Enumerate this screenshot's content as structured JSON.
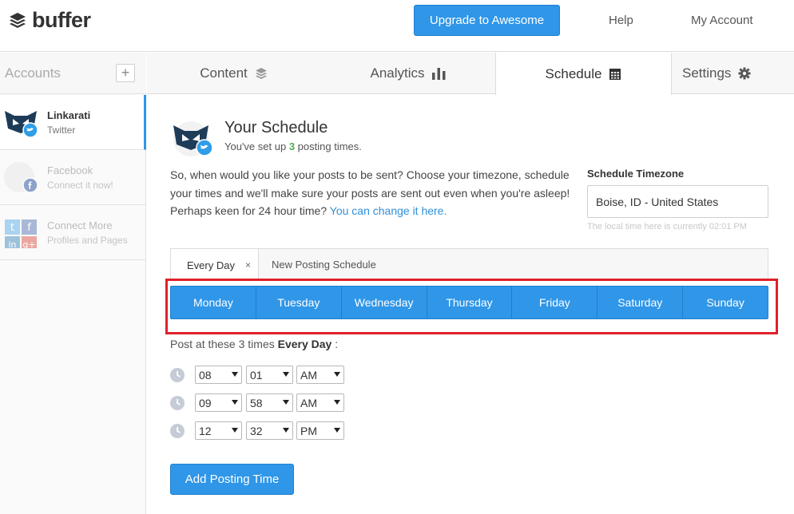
{
  "brand": {
    "name": "buffer"
  },
  "header": {
    "upgrade_label": "Upgrade to Awesome",
    "help_label": "Help",
    "account_label": "My Account"
  },
  "sidebar": {
    "title": "Accounts",
    "add_label": "+",
    "items": [
      {
        "name": "Linkarati",
        "sub": "Twitter"
      },
      {
        "name": "Facebook",
        "sub": "Connect it now!"
      },
      {
        "name": "Connect More",
        "sub": "Profiles and Pages"
      }
    ]
  },
  "tabs": [
    {
      "label": "Content",
      "icon": "layers-icon"
    },
    {
      "label": "Analytics",
      "icon": "bar-chart-icon"
    },
    {
      "label": "Schedule",
      "icon": "calendar-icon"
    },
    {
      "label": "Settings",
      "icon": "gear-icon"
    }
  ],
  "schedule": {
    "title": "Your Schedule",
    "sub_prefix": "You've set up",
    "count": "3",
    "sub_suffix": "posting times.",
    "intro": "So, when would you like your posts to be sent? Choose your timezone, schedule your times and we'll make sure your posts are sent out even when you're asleep!",
    "hour_prompt": "Perhaps keen for 24 hour time?",
    "hour_link": "You can change it here.",
    "timezone_label": "Schedule Timezone",
    "timezone_value": "Boise, ID - United States",
    "timezone_note": "The local time here is currently 02:01 PM",
    "sched_tab_active": "Every Day",
    "sched_tab_close": "×",
    "sched_tab_new": "New Posting Schedule",
    "days": [
      "Monday",
      "Tuesday",
      "Wednesday",
      "Thursday",
      "Friday",
      "Saturday",
      "Sunday"
    ],
    "post_prefix": "Post at these 3 times",
    "post_bold": "Every Day",
    "post_suffix": ":",
    "times": [
      {
        "hour": "08",
        "minute": "01",
        "ampm": "AM"
      },
      {
        "hour": "09",
        "minute": "58",
        "ampm": "AM"
      },
      {
        "hour": "12",
        "minute": "32",
        "ampm": "PM"
      }
    ],
    "add_label": "Add Posting Time"
  },
  "colors": {
    "accent": "#2f96e8",
    "highlight": "#e0202a",
    "count": "#4caf50"
  }
}
